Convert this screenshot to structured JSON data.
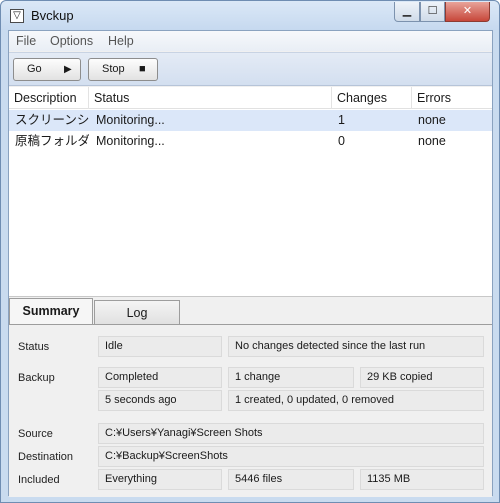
{
  "window": {
    "title": "Bvckup",
    "app_icon_glyph": "▽"
  },
  "menu": {
    "items": [
      "File",
      "Options",
      "Help"
    ]
  },
  "toolbar": {
    "go_label": "Go",
    "go_icon": "▶",
    "stop_label": "Stop",
    "stop_icon": "■"
  },
  "list": {
    "columns": [
      "Description",
      "Status",
      "Changes",
      "Errors"
    ],
    "rows": [
      {
        "description": "スクリーンシ",
        "status": "Monitoring...",
        "changes": "1",
        "errors": "none"
      },
      {
        "description": "原稿フォルダ",
        "status": "Monitoring...",
        "changes": "0",
        "errors": "none"
      }
    ]
  },
  "tabs": [
    "Summary",
    "Log"
  ],
  "summary": {
    "status_label": "Status",
    "status_value": "Idle",
    "status_detail": "No changes detected since the last run",
    "backup_label": "Backup",
    "backup_state": "Completed",
    "backup_changes": "1  change",
    "backup_copied": "29 KB copied",
    "backup_time": "5 seconds ago",
    "backup_detail": "1 created, 0 updated, 0 removed",
    "source_label": "Source",
    "source_value": "C:¥Users¥Yanagi¥Screen Shots",
    "destination_label": "Destination",
    "destination_value": "C:¥Backup¥ScreenShots",
    "included_label": "Included",
    "included_value": "Everything",
    "included_files": "5446 files",
    "included_size": "1135 MB"
  },
  "colors": {
    "selection": "#dbe7f9",
    "frame": "#c9dbef",
    "close_button": "#c7473a"
  }
}
